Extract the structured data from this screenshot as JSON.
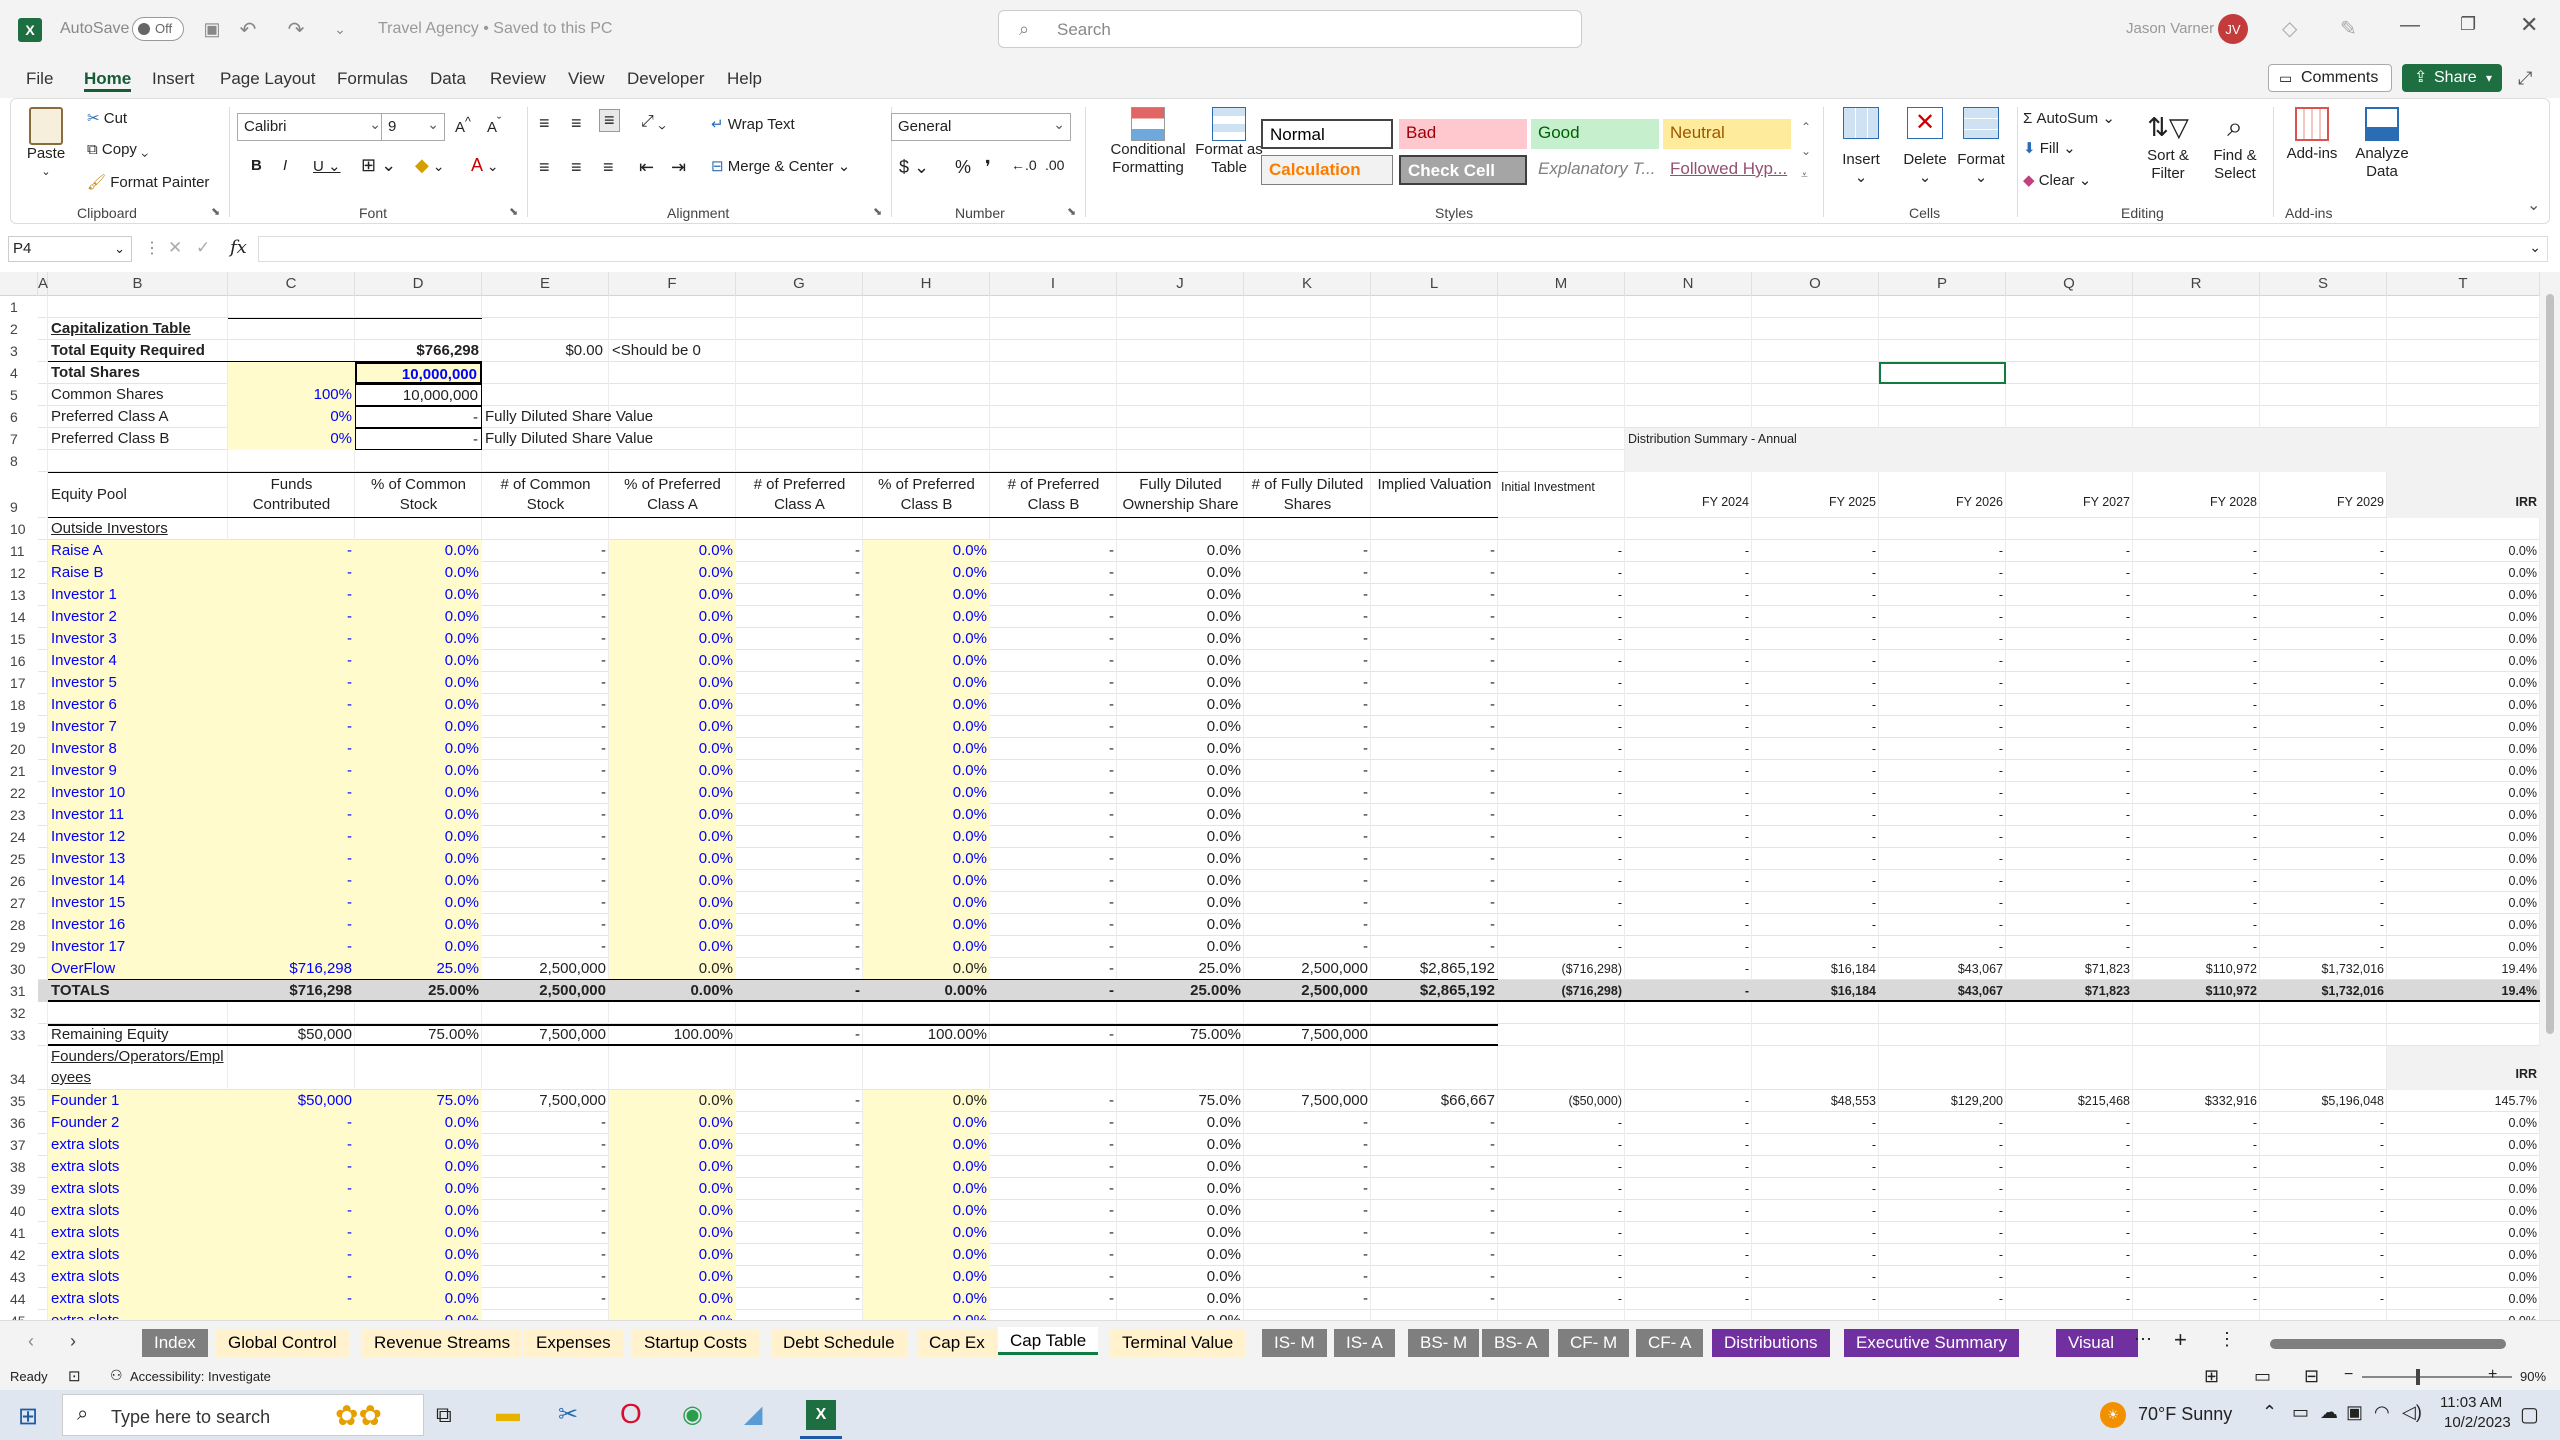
{
  "titlebar": {
    "autosave": "AutoSave",
    "autosave_state": "Off",
    "title": "Travel Agency • Saved to this PC",
    "search_placeholder": "Search",
    "user": "Jason Varner",
    "initials": "JV"
  },
  "ribbon_tabs": [
    "File",
    "Home",
    "Insert",
    "Page Layout",
    "Formulas",
    "Data",
    "Review",
    "View",
    "Developer",
    "Help"
  ],
  "comments": "Comments",
  "share": "Share",
  "ribbon": {
    "clipboard": {
      "paste": "Paste",
      "cut": "Cut",
      "copy": "Copy",
      "format_painter": "Format Painter",
      "label": "Clipboard"
    },
    "font": {
      "name": "Calibri",
      "size": "9",
      "label": "Font"
    },
    "alignment": {
      "wrap": "Wrap Text",
      "merge": "Merge & Center",
      "label": "Alignment"
    },
    "number": {
      "format": "General",
      "label": "Number"
    },
    "styles": {
      "cond": "Conditional Formatting",
      "table": "Format as Table",
      "label": "Styles",
      "cells": [
        "Normal",
        "Bad",
        "Good",
        "Neutral",
        "Calculation",
        "Check Cell",
        "Explanatory T...",
        "Followed Hyp..."
      ]
    },
    "cells": {
      "insert": "Insert",
      "delete": "Delete",
      "format": "Format",
      "label": "Cells"
    },
    "editing": {
      "autosum": "AutoSum",
      "fill": "Fill",
      "clear": "Clear",
      "sort": "Sort & Filter",
      "find": "Find & Select",
      "label": "Editing"
    },
    "addins": {
      "addins": "Add-ins",
      "analyze": "Analyze Data",
      "label": "Add-ins"
    }
  },
  "namebox": "P4",
  "fx": "fx",
  "columns": [
    "A",
    "B",
    "C",
    "D",
    "E",
    "F",
    "G",
    "H",
    "I",
    "J",
    "K",
    "L",
    "M",
    "N",
    "O",
    "P",
    "Q",
    "R",
    "S",
    "T"
  ],
  "sheet": {
    "cap_title": "Capitalization Table",
    "total_equity_label": "Total Equity Required",
    "total_equity": "$766,298",
    "check_val": "$0.00",
    "check_note": "<Should be 0",
    "total_shares_label": "Total Shares",
    "total_shares": "10,000,000",
    "common_label": "Common Shares",
    "common_pct": "100%",
    "common_val": "10,000,000",
    "prefA_label": "Preferred Class A",
    "prefA_pct": "0%",
    "prefA_val": "-",
    "prefA_note": "Fully Diluted Share Value",
    "prefB_label": "Preferred Class B",
    "prefB_pct": "0%",
    "prefB_val": "-",
    "prefB_note": "Fully Diluted Share Value",
    "dist_title": "Distribution Summary - Annual",
    "headers": [
      "Equity Pool",
      "Funds Contributed",
      "% of Common Stock",
      "# of Common Stock",
      "% of Preferred Class A",
      "# of Preferred Class A",
      "% of Preferred Class B",
      "# of Preferred Class B",
      "Fully Diluted Ownership Share",
      "# of Fully Diluted Shares",
      "Implied Valuation"
    ],
    "dist_headers": [
      "Initial Investment",
      "FY 2024",
      "FY 2025",
      "FY 2026",
      "FY 2027",
      "FY 2028",
      "FY 2029",
      "IRR"
    ],
    "outside_label": "Outside Investors",
    "investors": [
      "Raise A",
      "Raise B",
      "Investor 1",
      "Investor 2",
      "Investor 3",
      "Investor 4",
      "Investor 5",
      "Investor 6",
      "Investor 7",
      "Investor 8",
      "Investor 9",
      "Investor 10",
      "Investor 11",
      "Investor 12",
      "Investor 13",
      "Investor 14",
      "Investor 15",
      "Investor 16",
      "Investor 17"
    ],
    "dash": "-",
    "pct0": "0.0%",
    "pct0b": "0.0%",
    "overflow": {
      "name": "OverFlow",
      "funds": "$716,298",
      "pctc": "25.0%",
      "numc": "2,500,000",
      "pa": "0.0%",
      "na": "-",
      "pb": "0.0%",
      "nb": "-",
      "fd": "25.0%",
      "nfd": "2,500,000",
      "val": "$2,865,192",
      "dist": [
        "($716,298)",
        "-",
        "$16,184",
        "$43,067",
        "$71,823",
        "$110,972",
        "$1,732,016",
        "19.4%"
      ]
    },
    "totals": {
      "name": "TOTALS",
      "funds": "$716,298",
      "pctc": "25.00%",
      "numc": "2,500,000",
      "pa": "0.00%",
      "na": "-",
      "pb": "0.00%",
      "nb": "-",
      "fd": "25.00%",
      "nfd": "2,500,000",
      "val": "$2,865,192",
      "dist": [
        "($716,298)",
        "-",
        "$16,184",
        "$43,067",
        "$71,823",
        "$110,972",
        "$1,732,016",
        "19.4%"
      ]
    },
    "remaining": {
      "name": "Remaining Equity",
      "funds": "$50,000",
      "pctc": "75.00%",
      "numc": "7,500,000",
      "pa": "100.00%",
      "na": "-",
      "pb": "100.00%",
      "nb": "-",
      "fd": "75.00%",
      "nfd": "7,500,000"
    },
    "founders_label": "Founders/Operators/Employees",
    "irr_label": "IRR",
    "founder1": {
      "name": "Founder 1",
      "funds": "$50,000",
      "pctc": "75.0%",
      "numc": "7,500,000",
      "pa": "0.0%",
      "na": "-",
      "pb": "0.0%",
      "nb": "-",
      "fd": "75.0%",
      "nfd": "7,500,000",
      "val": "$66,667",
      "dist": [
        "($50,000)",
        "-",
        "$48,553",
        "$129,200",
        "$215,468",
        "$332,916",
        "$5,196,048",
        "145.7%"
      ]
    },
    "founder_rows": [
      "Founder 2",
      "extra slots",
      "extra slots",
      "extra slots",
      "extra slots",
      "extra slots",
      "extra slots",
      "extra slots",
      "extra slots",
      "extra slots"
    ]
  },
  "sheet_tabs": [
    "Index",
    "Global Control",
    "Revenue Streams",
    "Expenses",
    "Startup Costs",
    "Debt Schedule",
    "Cap Ex",
    "Cap Table",
    "Terminal Value",
    "IS- M",
    "IS- A",
    "BS- M",
    "BS- A",
    "CF- M",
    "CF- A",
    "Distributions",
    "Executive Summary",
    "Visuals"
  ],
  "status": {
    "ready": "Ready",
    "accessibility": "Accessibility: Investigate",
    "zoom": "90%"
  },
  "taskbar": {
    "search": "Type here to search",
    "weather": "70°F  Sunny",
    "time": "11:03 AM",
    "date": "10/2/2023"
  }
}
